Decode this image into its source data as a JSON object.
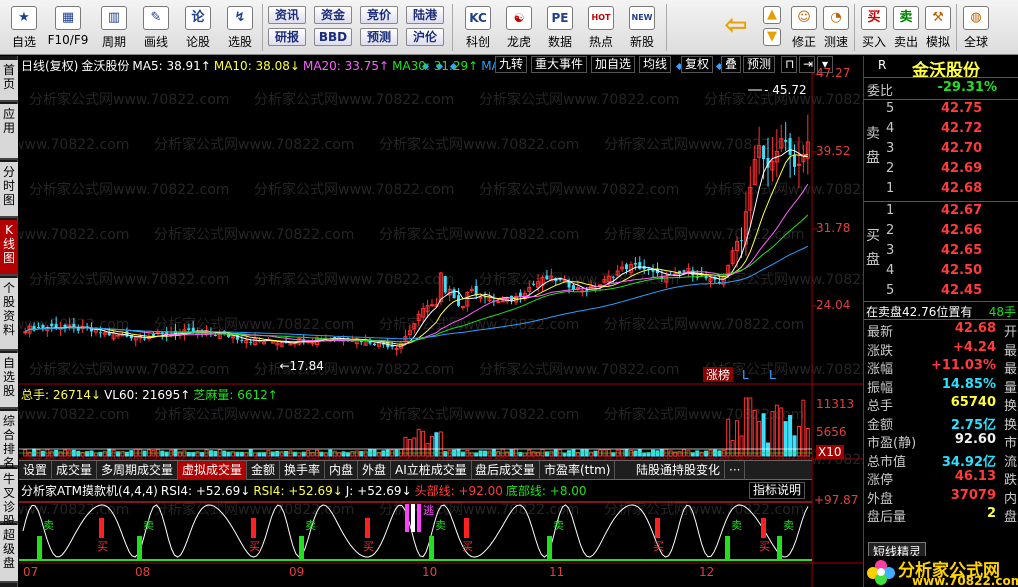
{
  "toolbar": {
    "items": [
      {
        "label": "自选",
        "icon": "star-icon",
        "glyph": "★"
      },
      {
        "label": "F10/F9",
        "icon": "grid-icon",
        "glyph": "▦"
      },
      {
        "label": "周期",
        "icon": "period-icon",
        "glyph": "▥"
      },
      {
        "label": "画线",
        "icon": "pen-icon",
        "glyph": "✎"
      },
      {
        "label": "论股",
        "icon": "discuss-icon",
        "glyph": "论"
      },
      {
        "label": "选股",
        "icon": "select-stock-icon",
        "glyph": "↯"
      }
    ],
    "pairs": [
      {
        "top": "资讯",
        "bottom": "研报"
      },
      {
        "top": "资金",
        "bottom": "BBD"
      },
      {
        "top": "竞价",
        "bottom": "预测"
      },
      {
        "top": "陆港",
        "bottom": "沪伦"
      }
    ],
    "items2": [
      {
        "label": "科创",
        "icon": "star-board-icon",
        "glyph": "KC"
      },
      {
        "label": "龙虎",
        "icon": "dragon-tiger-icon",
        "glyph": "☯"
      },
      {
        "label": "数据",
        "icon": "pe-data-icon",
        "glyph": "PE"
      },
      {
        "label": "热点",
        "icon": "hot-spot-icon",
        "glyph": "HOT"
      },
      {
        "label": "新股",
        "icon": "new-stock-icon",
        "glyph": "NEW"
      }
    ],
    "items3": [
      {
        "label": "修正",
        "icon": "correct-icon",
        "glyph": "☺"
      },
      {
        "label": "测速",
        "icon": "speed-test-icon",
        "glyph": "◔"
      },
      {
        "label": "买入",
        "icon": "buy-icon",
        "glyph": "买"
      },
      {
        "label": "卖出",
        "icon": "sell-icon",
        "glyph": "卖"
      },
      {
        "label": "模拟",
        "icon": "simulate-icon",
        "glyph": "⚒"
      },
      {
        "label": "全球",
        "icon": "globe-icon",
        "glyph": "◍"
      }
    ]
  },
  "left_tabs": [
    "首页",
    "应用",
    "分时图",
    "K线图",
    "个股资料",
    "自选股",
    "综合排名",
    "牛叉诊股",
    "超级盘"
  ],
  "left_tab_active": 3,
  "chart": {
    "legend_main": [
      {
        "text": "日线(复权)",
        "color": "#ffffff"
      },
      {
        "text": "金沃股份",
        "color": "#ffffff"
      },
      {
        "text": "MA5: 38.91↑",
        "color": "#ffffff"
      },
      {
        "text": "MA10: 38.08↓",
        "color": "#ffff40"
      },
      {
        "text": "MA20: 33.75↑",
        "color": "#ff60ff"
      },
      {
        "text": "MA30: 31.29↑",
        "color": "#20e020"
      },
      {
        "text": "MA60",
        "color": "#28a0ff"
      }
    ],
    "top_buttons": [
      "九转",
      "重大事件",
      "加自选",
      "均线",
      "复权",
      "叠",
      "预测"
    ],
    "price_axis": [
      "47.27",
      "39.52",
      "31.78",
      "24.04"
    ],
    "high_label": "45.72",
    "low_label": "17.84",
    "zhangbang": "涨榜",
    "L_marks": [
      "L",
      "L"
    ],
    "volume_legend": [
      {
        "text": "总手: 26714↓",
        "color": "#ffff40"
      },
      {
        "text": "VL60: 21695↑",
        "color": "#ffffff"
      },
      {
        "text": "芝麻量: 6612↑",
        "color": "#20e020"
      }
    ],
    "volume_axis": [
      "11313",
      "5656",
      "X10"
    ],
    "ind_tabs": [
      "设置",
      "成交量",
      "多周期成交量",
      "虚拟成交量",
      "金额",
      "换手率",
      "内盘",
      "外盘",
      "AI立桩成交量",
      "盘后成交量",
      "市盈率(ttm)",
      "陆股通持股变化",
      "···"
    ],
    "ind_tab_active": 3,
    "ind_legend": [
      {
        "text": "分析家ATM摸款机(4,4,4)",
        "color": "#ffffff"
      },
      {
        "text": "RSI4: +52.69↓",
        "color": "#ffffff"
      },
      {
        "text": "RSI4: +52.69↓",
        "color": "#ffff40"
      },
      {
        "text": "J: +52.69↓",
        "color": "#ffffff"
      },
      {
        "text": "头部线: +92.00",
        "color": "#ff3b3b"
      },
      {
        "text": "底部线: +8.00",
        "color": "#20e020"
      }
    ],
    "ind_help": "指标说明",
    "ind_axis": [
      "+97.87"
    ],
    "ind_labels": {
      "buy": "买",
      "sell": "卖",
      "escape": "逃"
    },
    "x_labels": [
      "07",
      "08",
      "09",
      "10",
      "11",
      "12"
    ],
    "watermark": "分析家公式网www.70822.com"
  },
  "right": {
    "code_hint": "R",
    "name": "金沃股份",
    "weibi_label": "委比",
    "weibi_value": "-29.31%",
    "sell_label": "卖盘",
    "buy_label": "买盘",
    "sells": [
      {
        "n": "5",
        "p": "42.75"
      },
      {
        "n": "4",
        "p": "42.72"
      },
      {
        "n": "3",
        "p": "42.70"
      },
      {
        "n": "2",
        "p": "42.69"
      },
      {
        "n": "1",
        "p": "42.68"
      }
    ],
    "buys": [
      {
        "n": "1",
        "p": "42.67"
      },
      {
        "n": "2",
        "p": "42.66"
      },
      {
        "n": "3",
        "p": "42.65"
      },
      {
        "n": "4",
        "p": "42.50"
      },
      {
        "n": "5",
        "p": "42.45"
      }
    ],
    "notice_left": "在卖盘42.76位置有",
    "notice_right": "48手",
    "stats": [
      {
        "k": "最新",
        "v": "42.68",
        "u": "开",
        "c": "red"
      },
      {
        "k": "涨跌",
        "v": "+4.24",
        "u": "最",
        "c": "red"
      },
      {
        "k": "涨幅",
        "v": "+11.03%",
        "u": "最",
        "c": "red"
      },
      {
        "k": "振幅",
        "v": "14.85%",
        "u": "量",
        "c": "cya"
      },
      {
        "k": "总手",
        "v": "65740",
        "u": "换",
        "c": "yel"
      },
      {
        "k": "金额",
        "v": "2.75亿",
        "u": "换",
        "c": "cya"
      },
      {
        "k": "市盈(静)",
        "v": "92.60",
        "u": "市",
        "c": "wht"
      },
      {
        "k": "总市值",
        "v": "34.92亿",
        "u": "流",
        "c": "cya"
      },
      {
        "k": "涨停",
        "v": "46.13",
        "u": "跌",
        "c": "red"
      },
      {
        "k": "外盘",
        "v": "37079",
        "u": "内",
        "c": "red"
      },
      {
        "k": "盘后量",
        "v": "2",
        "u": "盘",
        "c": "yel"
      }
    ],
    "bottom_hint": "短线精灵",
    "logo_text": "分析家公式网",
    "logo_url": "www.70822.com"
  }
}
